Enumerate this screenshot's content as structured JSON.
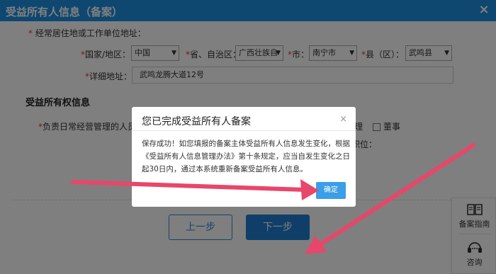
{
  "window": {
    "title": "受益所有人信息（备案）",
    "close_icon": "×"
  },
  "address_section": {
    "residence_label": "经常居住地或工作单位地址：",
    "country_label": "国家/地区：",
    "country_value": "中国",
    "province_label": "省、自治区：",
    "province_value": "广西壮族自",
    "city_label": "市：",
    "city_value": "南宁市",
    "county_label": "县（区）：",
    "county_value": "武鸣县",
    "detail_label": "详细地址：",
    "detail_value": "武鸣龙腾大道12号"
  },
  "ownership_section": {
    "title": "受益所有权信息",
    "mgmt_label": "负责日常经营管理的人员职",
    "option_manager": "理",
    "option_director": "董事",
    "position_label": "职位："
  },
  "dialog": {
    "title": "您已完成受益所有人备案",
    "close_icon": "×",
    "body": "保存成功！如您填报的备案主体受益所有人信息发生变化，根据《受益所有人信息管理办法》第十条规定，应当自发生变化之日起30日内，通过本系统重新备案受益所有人信息。",
    "ok_label": "确定"
  },
  "buttons": {
    "prev_label": "上一步",
    "next_label": "下一步"
  },
  "sidebar": {
    "guide_label": "备案指南",
    "consult_label": "咨询"
  },
  "colors": {
    "header_blue": "#1c8ee0",
    "required_red": "#e53935",
    "arrow_pink": "#e8466a",
    "ok_button": "#3a9ee8"
  }
}
